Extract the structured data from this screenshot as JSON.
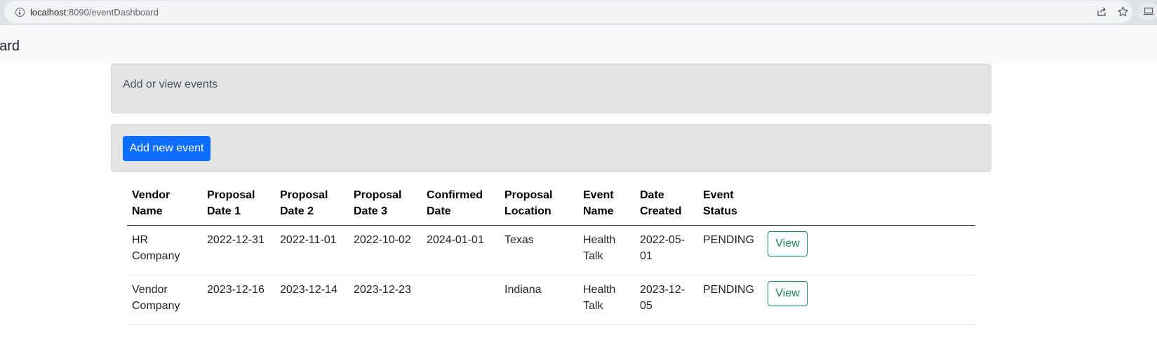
{
  "browser": {
    "url_host": "localhost",
    "url_path": ":8090/eventDashboard"
  },
  "navbar": {
    "brand": "oard"
  },
  "info_card": {
    "text": "Add or view events"
  },
  "actions": {
    "add_label": "Add new event"
  },
  "table": {
    "headers": {
      "vendor": "Vendor Name",
      "p1": "Proposal Date 1",
      "p2": "Proposal Date 2",
      "p3": "Proposal Date 3",
      "confirmed": "Confirmed Date",
      "location": "Proposal Location",
      "event_name": "Event Name",
      "created": "Date Created",
      "status": "Event Status"
    },
    "rows": [
      {
        "vendor": "HR Company",
        "p1": "2022-12-31",
        "p2": "2022-11-01",
        "p3": "2022-10-02",
        "confirmed": "2024-01-01",
        "location": "Texas",
        "event_name": "Health Talk",
        "created": "2022-05-01",
        "status": "PENDING",
        "action": "View"
      },
      {
        "vendor": "Vendor Company",
        "p1": "2023-12-16",
        "p2": "2023-12-14",
        "p3": "2023-12-23",
        "confirmed": "",
        "location": "Indiana",
        "event_name": "Health Talk",
        "created": "2023-12-05",
        "status": "PENDING",
        "action": "View"
      }
    ]
  },
  "colors": {
    "primary": "#0d6efd",
    "success": "#198754",
    "card_bg": "#e2e3e5",
    "navbar_bg": "#f8f9fa"
  },
  "icons": [
    "info-icon",
    "share-icon",
    "star-icon",
    "extension-icon"
  ]
}
